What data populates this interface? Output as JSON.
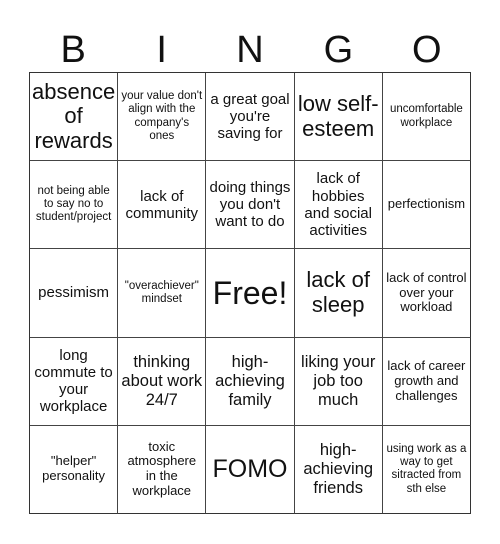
{
  "header": {
    "letters": [
      "B",
      "I",
      "N",
      "G",
      "O"
    ]
  },
  "board": {
    "cells": [
      "absence of rewards",
      "your value don't align with the company's ones",
      "a great goal you're saving for",
      "low self-esteem",
      "uncomfortable workplace",
      "not being able to say no to student/project",
      "lack of community",
      "doing things you don't want to do",
      "lack of hobbies and social activities",
      "perfectionism",
      "pessimism",
      "\"overachiever\" mindset",
      "Free!",
      "lack of sleep",
      "lack of control over your workload",
      "long commute to your workplace",
      "thinking about work 24/7",
      "high-achieving family",
      "liking your job too much",
      "lack of career growth and challenges",
      "\"helper\" personality",
      "toxic atmosphere in the workplace",
      "FOMO",
      "high-achieving friends",
      "using work as a way to get sitracted from sth else"
    ],
    "free_space_index": 12
  }
}
